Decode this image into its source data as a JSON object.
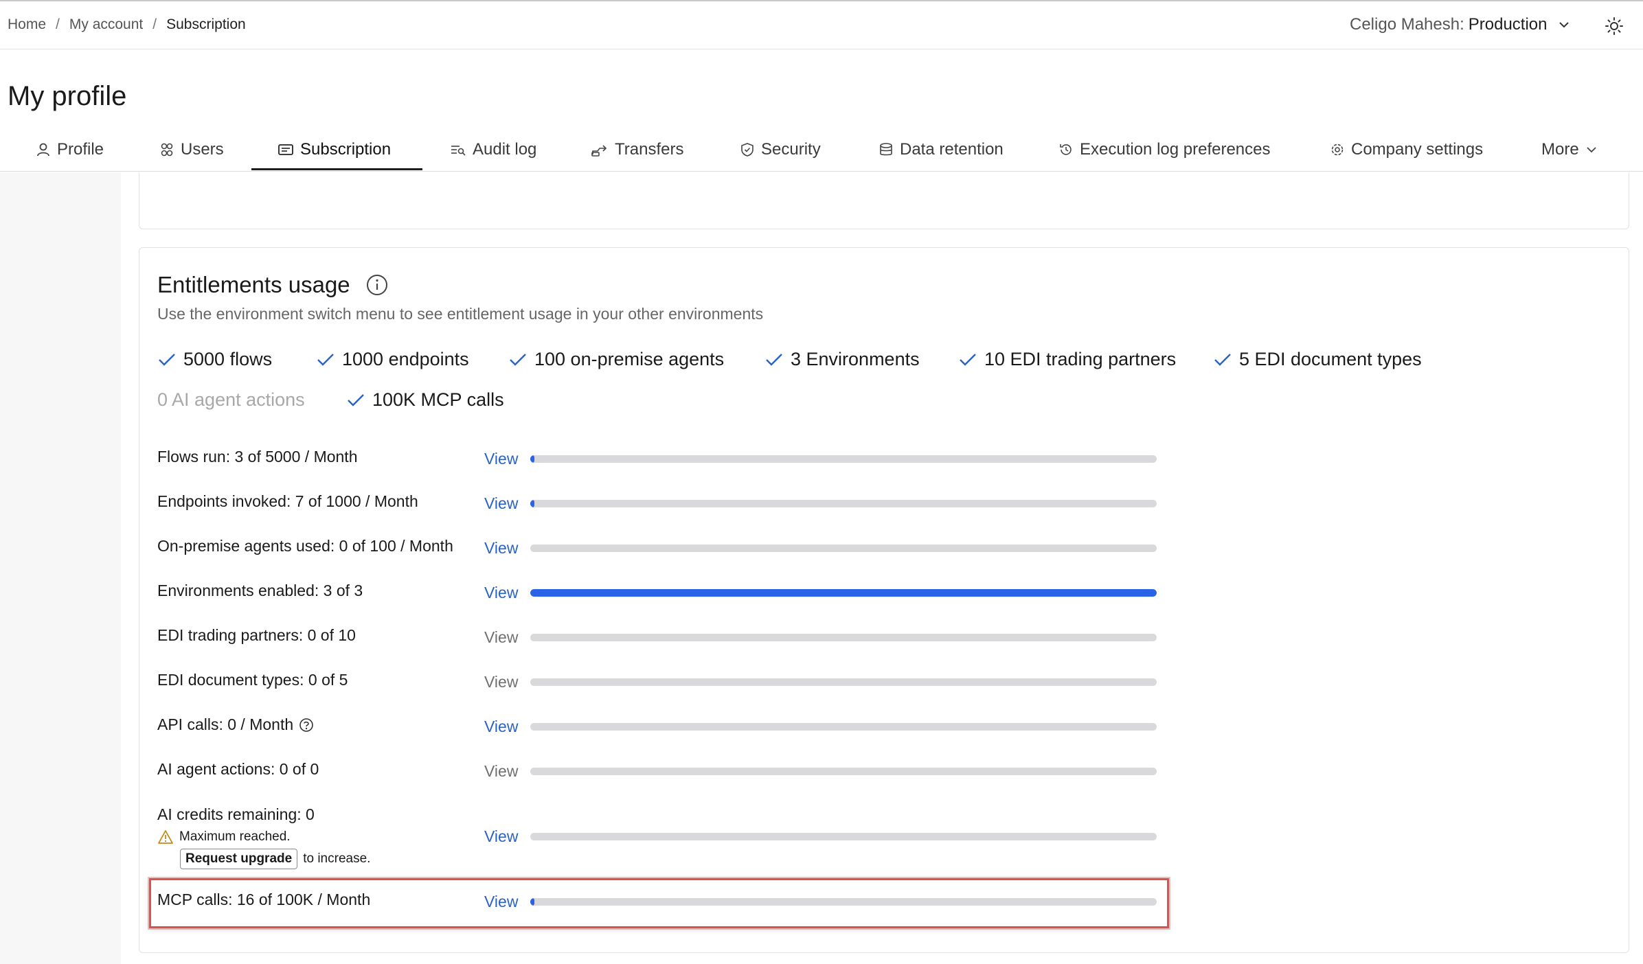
{
  "breadcrumb": {
    "home": "Home",
    "my_account": "My account",
    "current": "Subscription"
  },
  "env_switch": {
    "label": "Celigo Mahesh:",
    "value": "Production"
  },
  "page_title": "My profile",
  "tabs": {
    "profile": "Profile",
    "users": "Users",
    "subscription": "Subscription",
    "audit_log": "Audit log",
    "transfers": "Transfers",
    "security": "Security",
    "data_retention": "Data retention",
    "execution_log": "Execution log preferences",
    "company_settings": "Company settings",
    "more": "More"
  },
  "entitlements": {
    "title": "Entitlements usage",
    "subtitle": "Use the environment switch menu to see entitlement usage in your other environments",
    "items": [
      {
        "label": "5000 flows",
        "checked": true
      },
      {
        "label": "1000 endpoints",
        "checked": true
      },
      {
        "label": "100 on-premise agents",
        "checked": true
      },
      {
        "label": "3 Environments",
        "checked": true
      },
      {
        "label": "10 EDI trading partners",
        "checked": true
      },
      {
        "label": "5 EDI document types",
        "checked": true
      },
      {
        "label": "0 AI agent actions",
        "checked": false
      },
      {
        "label": "100K MCP calls",
        "checked": true
      }
    ]
  },
  "usage": {
    "view_label": "View",
    "rows": [
      {
        "label": "Flows run: 3 of 5000 / Month",
        "fraction": 0.0006,
        "view_enabled": true
      },
      {
        "label": "Endpoints invoked: 7 of 1000 / Month",
        "fraction": 0.007,
        "view_enabled": true
      },
      {
        "label": "On-premise agents used: 0 of 100 / Month",
        "fraction": 0,
        "view_enabled": true
      },
      {
        "label": "Environments enabled: 3 of 3",
        "fraction": 1,
        "view_enabled": true
      },
      {
        "label": "EDI trading partners: 0 of 10",
        "fraction": 0,
        "view_enabled": false
      },
      {
        "label": "EDI document types: 0 of 5",
        "fraction": 0,
        "view_enabled": false
      },
      {
        "label": "API calls: 0 / Month",
        "fraction": 0,
        "view_enabled": true
      },
      {
        "label": "AI agent actions: 0 of 0",
        "fraction": 0,
        "view_enabled": false
      },
      {
        "label": "AI credits remaining: 0",
        "fraction": 0,
        "view_enabled": true
      },
      {
        "label": "MCP calls: 16 of 100K / Month",
        "fraction": 0.00016,
        "view_enabled": true
      }
    ],
    "warning_text": "Maximum reached.",
    "upgrade_button": "Request upgrade",
    "upgrade_suffix": "to increase."
  },
  "colors": {
    "accent": "#2a63e6",
    "link": "#2a63c8",
    "highlight": "#d9534f"
  }
}
